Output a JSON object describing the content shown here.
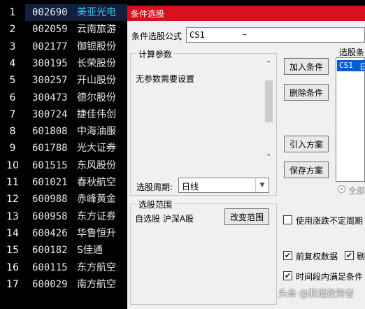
{
  "stocks": [
    {
      "idx": "1",
      "code": "002690",
      "name": "美亚光电"
    },
    {
      "idx": "2",
      "code": "002059",
      "name": "云南旅游"
    },
    {
      "idx": "3",
      "code": "002177",
      "name": "御银股份"
    },
    {
      "idx": "4",
      "code": "300195",
      "name": "长荣股份"
    },
    {
      "idx": "5",
      "code": "300257",
      "name": "开山股份"
    },
    {
      "idx": "6",
      "code": "300473",
      "name": "德尔股份"
    },
    {
      "idx": "7",
      "code": "300724",
      "name": "捷佳伟创"
    },
    {
      "idx": "8",
      "code": "601808",
      "name": "中海油服"
    },
    {
      "idx": "9",
      "code": "601788",
      "name": "光大证券"
    },
    {
      "idx": "10",
      "code": "601515",
      "name": "东风股份"
    },
    {
      "idx": "11",
      "code": "601021",
      "name": "春秋航空"
    },
    {
      "idx": "12",
      "code": "600988",
      "name": "赤峰黄金"
    },
    {
      "idx": "13",
      "code": "600958",
      "name": "东方证券"
    },
    {
      "idx": "14",
      "code": "600426",
      "name": "华鲁恒升"
    },
    {
      "idx": "15",
      "code": "600182",
      "name": "S佳通"
    },
    {
      "idx": "16",
      "code": "600115",
      "name": "东方航空"
    },
    {
      "idx": "17",
      "code": "600029",
      "name": "南方航空"
    }
  ],
  "dialog": {
    "title": "条件选股",
    "formula_label": "条件选股公式",
    "formula_value": "CS1",
    "formula_dash": "–",
    "calc_params": {
      "title": "计算参数",
      "text": "无参数需要设置",
      "period_label": "选股周期:",
      "period_value": "日线"
    },
    "buttons": {
      "add": "加入条件",
      "delete": "删除条件",
      "import": "引入方案",
      "save": "保存方案",
      "change_range": "改变范围"
    },
    "selected_conditions": {
      "title": "选股条",
      "item_code": "CS1",
      "item_extra": "日",
      "all_label": "全部"
    },
    "range": {
      "title": "选股范围",
      "value": "自选股 沪深A股"
    },
    "options": {
      "limit_unfixed": "使用涨跌不定周期",
      "pre_rights": "前复权数据",
      "pre_rights_extra": "剔",
      "time_period": "时间段内满足条件"
    }
  },
  "watermark": "头条 @股道投资者"
}
